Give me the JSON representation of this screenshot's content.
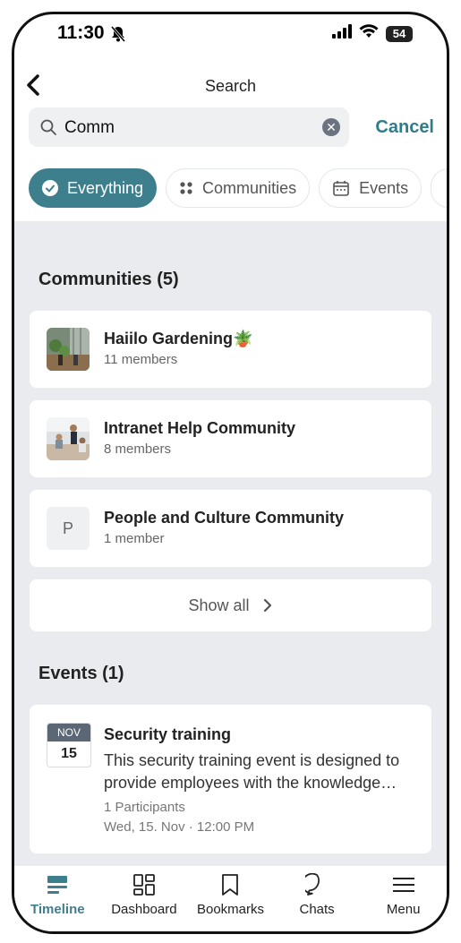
{
  "status_bar": {
    "time": "11:30",
    "battery": "54"
  },
  "header": {
    "title": "Search"
  },
  "search": {
    "value": "Comm",
    "cancel_label": "Cancel"
  },
  "filters": [
    {
      "label": "Everything"
    },
    {
      "label": "Communities"
    },
    {
      "label": "Events"
    }
  ],
  "communities": {
    "title": "Communities (5)",
    "items": [
      {
        "name": "Haiilo Gardening🪴",
        "members": "11 members"
      },
      {
        "name": "Intranet Help Community",
        "members": "8 members"
      },
      {
        "name": "People and Culture Community",
        "members": "1 member",
        "initial": "P"
      }
    ],
    "show_all": "Show all"
  },
  "events": {
    "title": "Events (1)",
    "items": [
      {
        "month": "NOV",
        "day": "15",
        "name": "Security training",
        "description_line1": "This security training event is designed to",
        "description_line2": "provide employees with the knowledge…",
        "participants": "1 Participants",
        "date": "Wed, 15. Nov · 12:00 PM"
      }
    ]
  },
  "tab_bar": [
    {
      "label": "Timeline"
    },
    {
      "label": "Dashboard"
    },
    {
      "label": "Bookmarks"
    },
    {
      "label": "Chats"
    },
    {
      "label": "Menu"
    }
  ],
  "colors": {
    "accent": "#3e7f8d",
    "background": "#e9ebee"
  }
}
